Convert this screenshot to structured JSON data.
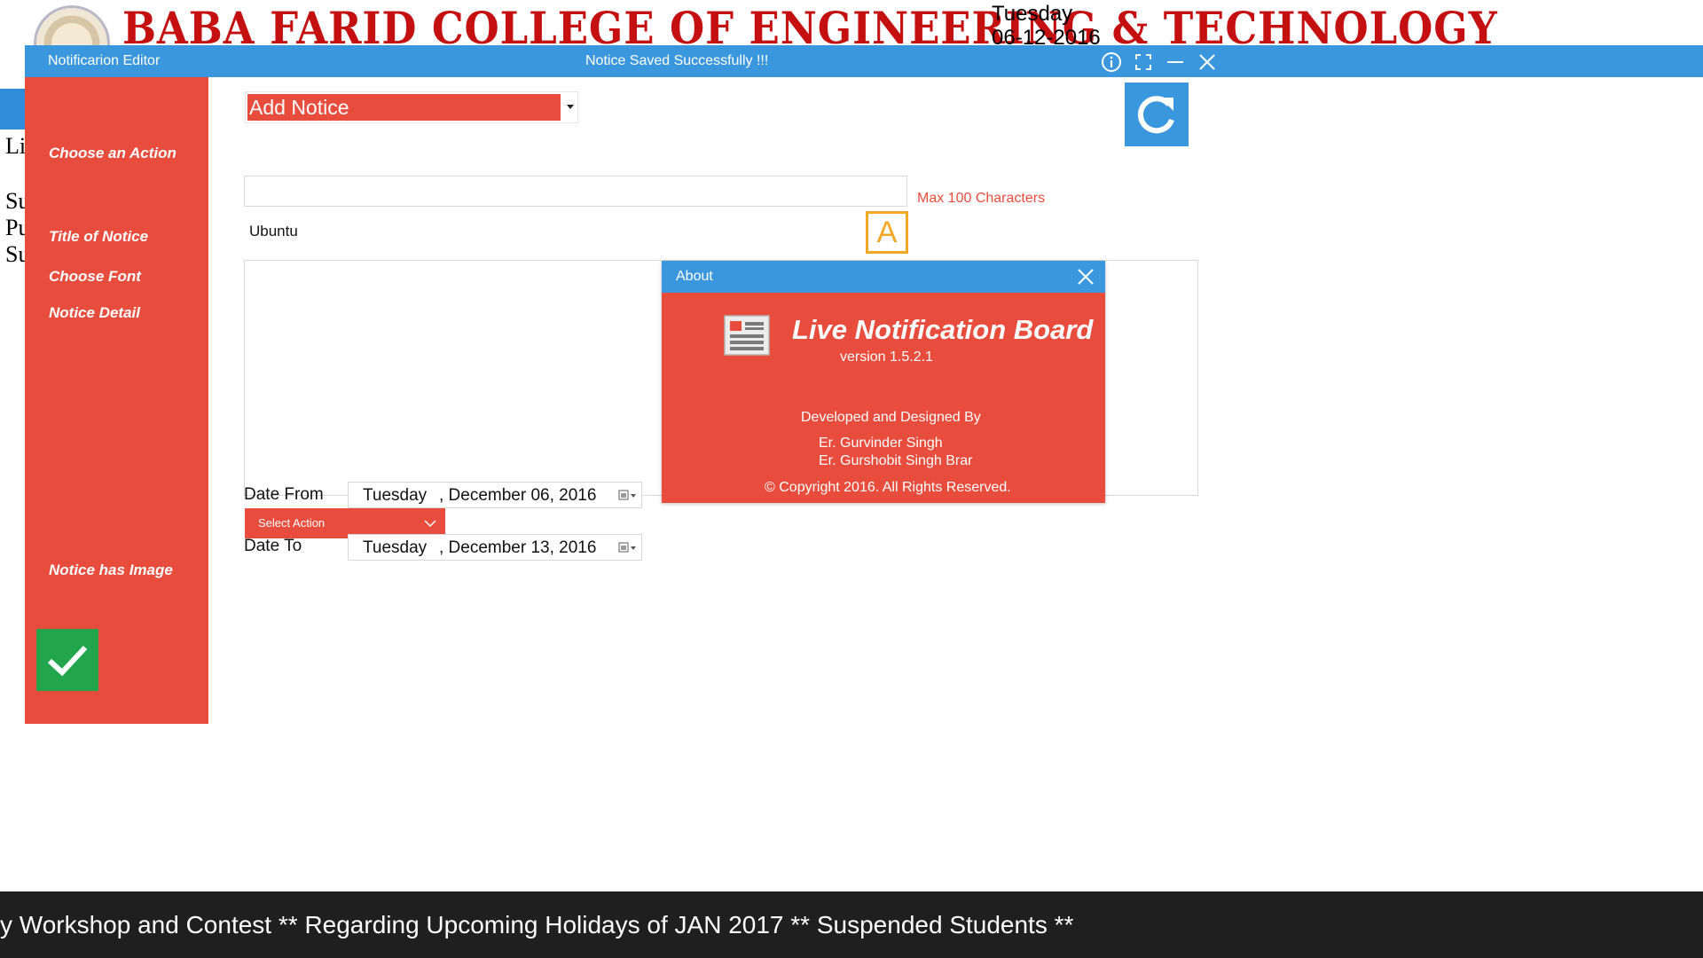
{
  "background": {
    "college_name": "BABA FARID COLLEGE OF ENGINEERING & TECHNOLOGY",
    "day": "Tuesday",
    "date": "06-12-2016",
    "side_fragments": [
      "Li",
      "Su",
      "Pu",
      "Su"
    ],
    "ticker": "y Workshop and Contest ** Regarding Upcoming Holidays of JAN 2017 ** Suspended Students **"
  },
  "editor": {
    "title": "Notificarion Editor",
    "status": "Notice Saved Successfully !!!",
    "sidebar": {
      "choose_action": "Choose an Action",
      "title_of_notice": "Title of Notice",
      "choose_font": "Choose Font",
      "notice_detail": "Notice Detail",
      "notice_has_image": "Notice has Image"
    },
    "action_select": {
      "value": "Add Notice"
    },
    "title_input": {
      "value": "",
      "hint": "Max 100 Characters"
    },
    "font": {
      "name": "Ubuntu",
      "button_glyph": "A"
    },
    "detail": {
      "value": ""
    },
    "image_select": {
      "value": "Select Action"
    },
    "date_from": {
      "label": "Date From",
      "day": "Tuesday",
      "date": ", December 06, 2016"
    },
    "date_to": {
      "label": "Date To",
      "day": "Tuesday",
      "date": ", December 13, 2016"
    }
  },
  "about": {
    "title": "About",
    "app_name": "Live Notification Board",
    "version": "version 1.5.2.1",
    "developed_by": "Developed and Designed By",
    "developers": [
      "Er. Gurvinder Singh",
      "Er. Gurshobit Singh Brar"
    ],
    "copyright": "© Copyright 2016. All Rights Reserved."
  },
  "colors": {
    "accent_red": "#e84c3d",
    "title_blue": "#3b97dd",
    "confirm_green": "#23a54e",
    "font_orange": "#f5a623",
    "ticker_bg": "#1f1f1f"
  },
  "icons": {
    "info": "info-icon",
    "maximize": "maximize-icon",
    "minimize": "minimize-icon",
    "close": "close-icon",
    "refresh": "refresh-icon",
    "confirm": "checkmark-icon",
    "app": "newspaper-icon",
    "calendar": "calendar-icon"
  }
}
